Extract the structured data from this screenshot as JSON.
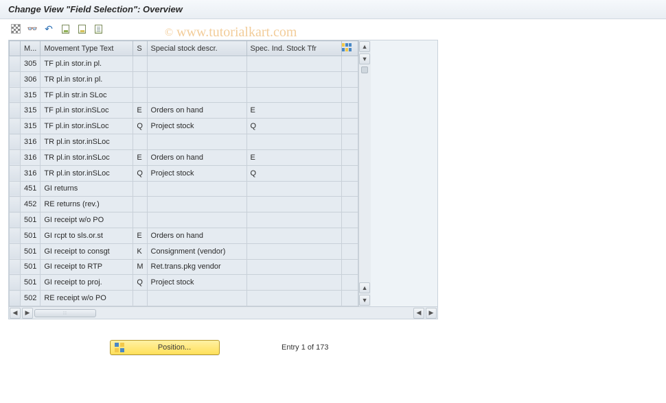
{
  "title": "Change View \"Field Selection\": Overview",
  "watermark": {
    "prefix": "©",
    "text": "www.tutorialkart.com"
  },
  "toolbar": {
    "other_view": "Other view",
    "glasses": "Display/Change",
    "undo": "Undo",
    "save_variant": "Save",
    "select_all": "Select all",
    "deselect_all": "Deselect all"
  },
  "columns": {
    "m": "M...",
    "movement_text": "Movement Type Text",
    "s": "S",
    "special_stock": "Special stock descr.",
    "spec_ind": "Spec. Ind. Stock Tfr"
  },
  "rows": [
    {
      "m": "305",
      "txt": "TF pl.in stor.in pl.",
      "s": "",
      "desc": "",
      "spec": ""
    },
    {
      "m": "306",
      "txt": "TR pl.in stor.in pl.",
      "s": "",
      "desc": "",
      "spec": ""
    },
    {
      "m": "315",
      "txt": "TF pl.in str.in SLoc",
      "s": "",
      "desc": "",
      "spec": ""
    },
    {
      "m": "315",
      "txt": "TF pl.in stor.inSLoc",
      "s": "E",
      "desc": "Orders on hand",
      "spec": "E"
    },
    {
      "m": "315",
      "txt": "TF pl.in stor.inSLoc",
      "s": "Q",
      "desc": "Project stock",
      "spec": "Q"
    },
    {
      "m": "316",
      "txt": "TR pl.in stor.inSLoc",
      "s": "",
      "desc": "",
      "spec": ""
    },
    {
      "m": "316",
      "txt": "TR pl.in stor.inSLoc",
      "s": "E",
      "desc": "Orders on hand",
      "spec": "E"
    },
    {
      "m": "316",
      "txt": "TR pl.in stor.inSLoc",
      "s": "Q",
      "desc": "Project stock",
      "spec": "Q"
    },
    {
      "m": "451",
      "txt": "GI returns",
      "s": "",
      "desc": "",
      "spec": ""
    },
    {
      "m": "452",
      "txt": "RE returns (rev.)",
      "s": "",
      "desc": "",
      "spec": ""
    },
    {
      "m": "501",
      "txt": "GI receipt w/o PO",
      "s": "",
      "desc": "",
      "spec": ""
    },
    {
      "m": "501",
      "txt": "GI rcpt to sls.or.st",
      "s": "E",
      "desc": "Orders on hand",
      "spec": ""
    },
    {
      "m": "501",
      "txt": "GI receipt to consgt",
      "s": "K",
      "desc": "Consignment (vendor)",
      "spec": ""
    },
    {
      "m": "501",
      "txt": "GI receipt to RTP",
      "s": "M",
      "desc": "Ret.trans.pkg vendor",
      "spec": ""
    },
    {
      "m": "501",
      "txt": "GI receipt to proj.",
      "s": "Q",
      "desc": "Project stock",
      "spec": ""
    },
    {
      "m": "502",
      "txt": "RE receipt w/o PO",
      "s": "",
      "desc": "",
      "spec": ""
    }
  ],
  "footer": {
    "position_label": "Position...",
    "entry_status": "Entry 1 of 173"
  }
}
